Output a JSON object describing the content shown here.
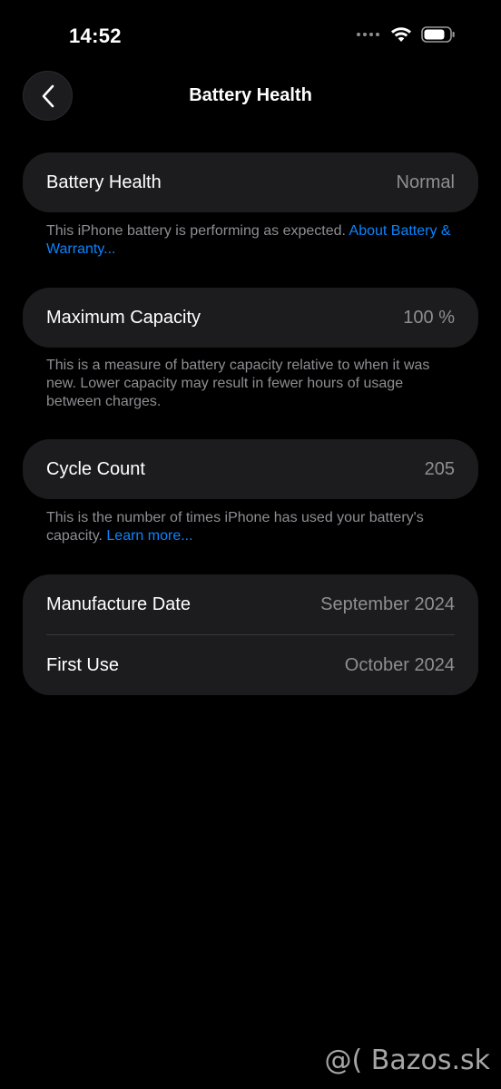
{
  "status_bar": {
    "time": "14:52"
  },
  "nav": {
    "title": "Battery Health"
  },
  "sections": {
    "health": {
      "label": "Battery Health",
      "value": "Normal",
      "footnote": "This iPhone battery is performing as expected. ",
      "footnote_link": "About Battery & Warranty..."
    },
    "capacity": {
      "label": "Maximum Capacity",
      "value": "100 %",
      "footnote": "This is a measure of battery capacity relative to when it was new. Lower capacity may result in fewer hours of usage between charges."
    },
    "cycles": {
      "label": "Cycle Count",
      "value": "205",
      "footnote": "This is the number of times iPhone has used your battery's capacity. ",
      "footnote_link": "Learn more..."
    },
    "dates": {
      "manufacture_label": "Manufacture Date",
      "manufacture_value": "September 2024",
      "first_use_label": "First Use",
      "first_use_value": "October 2024"
    }
  },
  "watermark": "@( Bazos.sk",
  "colors": {
    "background": "#000000",
    "card": "#1c1c1e",
    "secondary_text": "#8e8e93",
    "link": "#0a84ff"
  }
}
